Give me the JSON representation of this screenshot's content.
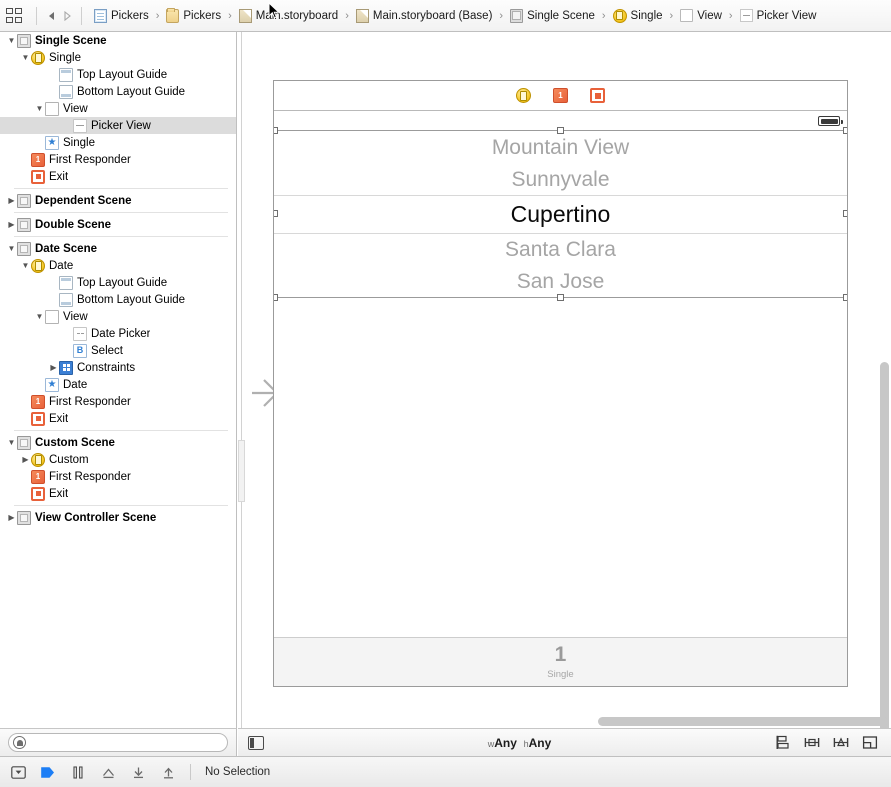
{
  "jumpbar": {
    "editor_icon": "grid-icon",
    "back_label": "back-arrow",
    "forward_label": "forward-arrow",
    "crumbs": [
      {
        "label": "Pickers",
        "icon": "project-document-icon"
      },
      {
        "label": "Pickers",
        "icon": "folder-icon"
      },
      {
        "label": "Main.storyboard",
        "icon": "storyboard-icon"
      },
      {
        "label": "Main.storyboard (Base)",
        "icon": "storyboard-icon"
      },
      {
        "label": "Single Scene",
        "icon": "scene-icon"
      },
      {
        "label": "Single",
        "icon": "view-controller-icon"
      },
      {
        "label": "View",
        "icon": "view-icon"
      },
      {
        "label": "Picker View",
        "icon": "picker-view-icon"
      }
    ],
    "separator": "›"
  },
  "outline": {
    "groups": [
      {
        "rows": [
          {
            "label": "Single Scene",
            "icon": "scene-icon",
            "indent": 0,
            "twisty": "down",
            "bold": true,
            "selected": false
          },
          {
            "label": "Single",
            "icon": "view-controller-icon",
            "indent": 1,
            "twisty": "down",
            "bold": false,
            "selected": false
          },
          {
            "label": "Top Layout Guide",
            "icon": "top-layout-guide-icon",
            "indent": 3,
            "twisty": "",
            "bold": false,
            "selected": false
          },
          {
            "label": "Bottom Layout Guide",
            "icon": "bottom-layout-guide-icon",
            "indent": 3,
            "twisty": "",
            "bold": false,
            "selected": false
          },
          {
            "label": "View",
            "icon": "view-icon",
            "indent": 2,
            "twisty": "down",
            "bold": false,
            "selected": false
          },
          {
            "label": "Picker View",
            "icon": "picker-view-icon",
            "indent": 4,
            "twisty": "",
            "bold": false,
            "selected": true
          },
          {
            "label": "Single",
            "icon": "placeholder-star-icon",
            "indent": 2,
            "twisty": "",
            "bold": false,
            "selected": false
          },
          {
            "label": "First Responder",
            "icon": "first-responder-icon",
            "indent": 1,
            "twisty": "",
            "bold": false,
            "selected": false
          },
          {
            "label": "Exit",
            "icon": "exit-icon",
            "indent": 1,
            "twisty": "",
            "bold": false,
            "selected": false
          }
        ]
      },
      {
        "rows": [
          {
            "label": "Dependent Scene",
            "icon": "scene-icon",
            "indent": 0,
            "twisty": "right",
            "bold": true,
            "selected": false
          }
        ]
      },
      {
        "rows": [
          {
            "label": "Double Scene",
            "icon": "scene-icon",
            "indent": 0,
            "twisty": "right",
            "bold": true,
            "selected": false
          }
        ]
      },
      {
        "rows": [
          {
            "label": "Date Scene",
            "icon": "scene-icon",
            "indent": 0,
            "twisty": "down",
            "bold": true,
            "selected": false
          },
          {
            "label": "Date",
            "icon": "view-controller-icon",
            "indent": 1,
            "twisty": "down",
            "bold": false,
            "selected": false
          },
          {
            "label": "Top Layout Guide",
            "icon": "top-layout-guide-icon",
            "indent": 3,
            "twisty": "",
            "bold": false,
            "selected": false
          },
          {
            "label": "Bottom Layout Guide",
            "icon": "bottom-layout-guide-icon",
            "indent": 3,
            "twisty": "",
            "bold": false,
            "selected": false
          },
          {
            "label": "View",
            "icon": "view-icon",
            "indent": 2,
            "twisty": "down",
            "bold": false,
            "selected": false
          },
          {
            "label": "Date Picker",
            "icon": "date-picker-icon",
            "indent": 4,
            "twisty": "",
            "bold": false,
            "selected": false
          },
          {
            "label": "Select",
            "icon": "button-icon",
            "indent": 4,
            "twisty": "",
            "bold": false,
            "selected": false
          },
          {
            "label": "Constraints",
            "icon": "constraints-icon",
            "indent": 3,
            "twisty": "right",
            "bold": false,
            "selected": false
          },
          {
            "label": "Date",
            "icon": "placeholder-star-icon",
            "indent": 2,
            "twisty": "",
            "bold": false,
            "selected": false
          },
          {
            "label": "First Responder",
            "icon": "first-responder-icon",
            "indent": 1,
            "twisty": "",
            "bold": false,
            "selected": false
          },
          {
            "label": "Exit",
            "icon": "exit-icon",
            "indent": 1,
            "twisty": "",
            "bold": false,
            "selected": false
          }
        ]
      },
      {
        "rows": [
          {
            "label": "Custom Scene",
            "icon": "scene-icon",
            "indent": 0,
            "twisty": "down",
            "bold": true,
            "selected": false
          },
          {
            "label": "Custom",
            "icon": "view-controller-icon",
            "indent": 1,
            "twisty": "right",
            "bold": false,
            "selected": false
          },
          {
            "label": "First Responder",
            "icon": "first-responder-icon",
            "indent": 1,
            "twisty": "",
            "bold": false,
            "selected": false
          },
          {
            "label": "Exit",
            "icon": "exit-icon",
            "indent": 1,
            "twisty": "",
            "bold": false,
            "selected": false
          }
        ]
      },
      {
        "rows": [
          {
            "label": "View Controller Scene",
            "icon": "scene-icon",
            "indent": 0,
            "twisty": "right",
            "bold": true,
            "selected": false
          }
        ]
      }
    ]
  },
  "canvas": {
    "dock": [
      {
        "name": "view-controller-dock-icon",
        "label": "Single"
      },
      {
        "name": "first-responder-dock-icon",
        "label": "First Responder"
      },
      {
        "name": "exit-dock-icon",
        "label": "Exit"
      }
    ],
    "picker": {
      "rows": [
        "Mountain View",
        "Sunnyvale",
        "Cupertino",
        "Santa Clara",
        "San Jose"
      ],
      "selected_index": 2,
      "selected_value": "Cupertino"
    },
    "footer": {
      "number": "1",
      "label": "Single"
    },
    "status_bar_icon": "battery-icon",
    "entry_point_icon": "storyboard-entry-point-arrow"
  },
  "filterbar": {
    "icon": "filter-icon",
    "value": "",
    "placeholder": ""
  },
  "sizebar": {
    "panel_toggle_icon": "document-outline-toggle-icon",
    "size_class": {
      "w_prefix": "w",
      "w_value": "Any",
      "h_prefix": "h",
      "h_value": "Any"
    },
    "tools": [
      {
        "name": "align-button",
        "icon": "align-icon"
      },
      {
        "name": "pin-button",
        "icon": "pin-icon"
      },
      {
        "name": "resolve-auto-layout-issues-button",
        "icon": "resolve-issues-icon"
      },
      {
        "name": "resizing-behavior-button",
        "icon": "resizing-behavior-icon"
      }
    ]
  },
  "debugbar": {
    "tools": [
      {
        "name": "hide-debug-area-button",
        "icon": "hide-debug-area-icon"
      },
      {
        "name": "continue-execution-button",
        "icon": "continue-icon"
      },
      {
        "name": "step-over-button",
        "icon": "step-over-icon"
      },
      {
        "name": "step-into-button",
        "icon": "step-into-icon"
      },
      {
        "name": "step-out-button",
        "icon": "step-out-icon"
      },
      {
        "name": "step-up-button",
        "icon": "step-up-icon"
      }
    ],
    "status": "No Selection"
  }
}
